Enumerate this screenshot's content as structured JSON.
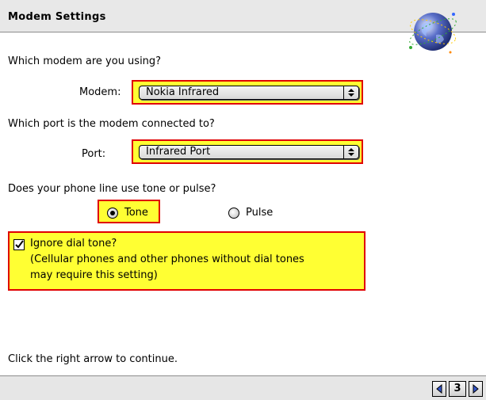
{
  "header": {
    "title": "Modem Settings"
  },
  "modem": {
    "question": "Which modem are you using?",
    "label": "Modem:",
    "selected": "Nokia Infrared"
  },
  "port": {
    "question": "Which port is the modem connected to?",
    "label": "Port:",
    "selected": "Infrared Port"
  },
  "dial": {
    "question": "Does your phone line use tone or pulse?",
    "tone_label": "Tone",
    "pulse_label": "Pulse",
    "selected": "Tone"
  },
  "dial_tone": {
    "label": "Ignore dial tone?",
    "note_line1": "(Cellular phones and other phones without dial tones",
    "note_line2": "may require this setting)",
    "checked": true
  },
  "instruction": "Click the right arrow to continue.",
  "footer": {
    "page_number": "3"
  },
  "colors": {
    "highlight": "#ffff33",
    "highlight_border": "#e00000"
  }
}
